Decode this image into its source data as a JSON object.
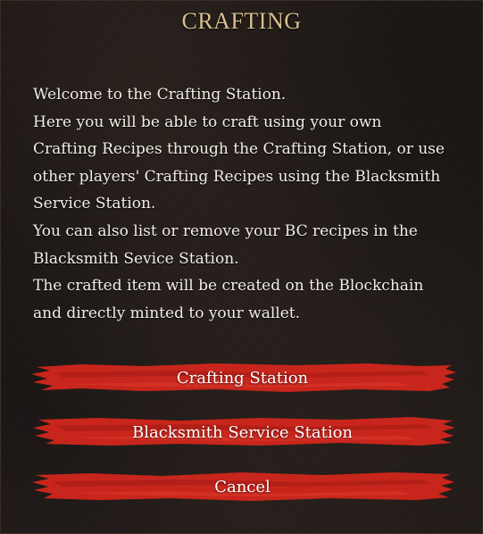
{
  "dialog": {
    "title": "CRAFTING",
    "body_lines": [
      "Welcome to the Crafting Station.",
      "Here you will be able to craft using your own",
      "Crafting Recipes through the Crafting Station, or use",
      "other players' Crafting Recipes using the Blacksmith",
      "Service Station.",
      "You can also list or remove your BC recipes in the",
      "Blacksmith Sevice Station.",
      "The crafted item will be created on the Blockchain",
      "and directly minted to your wallet."
    ],
    "buttons": {
      "crafting_station": "Crafting Station",
      "blacksmith_service_station": "Blacksmith Service Station",
      "cancel": "Cancel"
    }
  },
  "colors": {
    "title": "#d7c08f",
    "button_stroke": "#c8261c",
    "button_stroke_dark": "#9e1a13",
    "background": "#1a1615"
  }
}
